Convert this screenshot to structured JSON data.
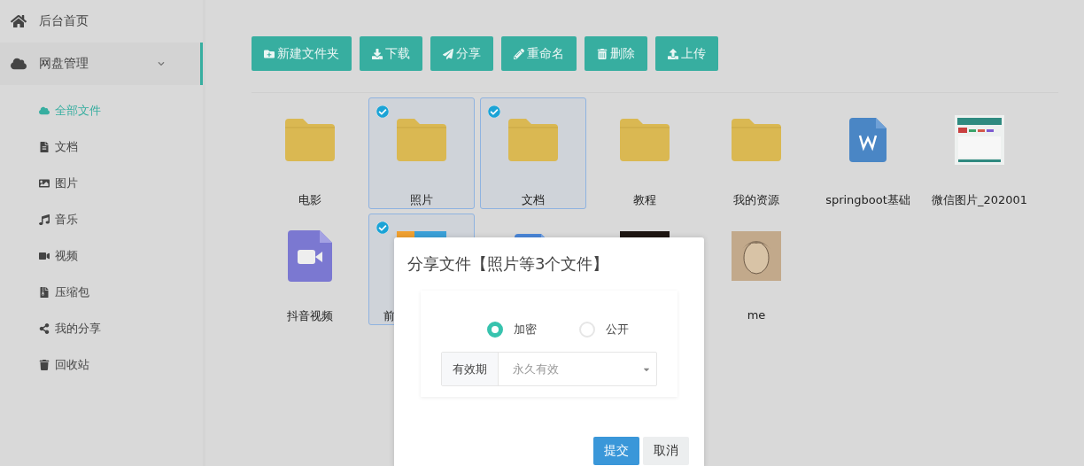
{
  "sidebar": {
    "items": [
      {
        "label": "后台首页",
        "selected": false
      },
      {
        "label": "网盘管理",
        "selected": true,
        "expanded": true,
        "children": [
          {
            "label": "全部文件",
            "selected": true
          },
          {
            "label": "文档",
            "selected": false
          },
          {
            "label": "图片",
            "selected": false
          },
          {
            "label": "音乐",
            "selected": false
          },
          {
            "label": "视频",
            "selected": false
          },
          {
            "label": "压缩包",
            "selected": false
          },
          {
            "label": "我的分享",
            "selected": false
          },
          {
            "label": "回收站",
            "selected": false
          }
        ]
      }
    ]
  },
  "toolbar": [
    "新建文件夹",
    "下载",
    "分享",
    "重命名",
    "删除",
    "上传"
  ],
  "files": [
    {
      "name": "电影",
      "kind": "folder",
      "selected": false
    },
    {
      "name": "照片",
      "kind": "folder",
      "selected": true
    },
    {
      "name": "文档",
      "kind": "folder",
      "selected": true
    },
    {
      "name": "教程",
      "kind": "folder",
      "selected": false
    },
    {
      "name": "我的资源",
      "kind": "folder",
      "selected": false
    },
    {
      "name": "springboot基础",
      "kind": "word",
      "selected": false
    },
    {
      "name": "微信图片_202001",
      "kind": "picture",
      "selected": false
    },
    {
      "name": "抖音视频",
      "kind": "video",
      "selected": false
    },
    {
      "name": "前",
      "kind": "picture",
      "selected": true,
      "clipped": true
    },
    {
      "kind": "doc",
      "selected": false
    },
    {
      "kind": "picture",
      "selected": false
    },
    {
      "name": "me",
      "kind": "picture",
      "selected": false
    }
  ],
  "dialog": {
    "title": "分享文件【照片等3个文件】",
    "options": [
      {
        "label": "加密",
        "selected": true
      },
      {
        "label": "公开",
        "selected": false
      }
    ],
    "expiry": {
      "label": "有效期",
      "value": "永久有效"
    },
    "buttons": [
      {
        "label": "提交",
        "kind": "primary"
      },
      {
        "label": "取消",
        "kind": "default"
      }
    ]
  }
}
